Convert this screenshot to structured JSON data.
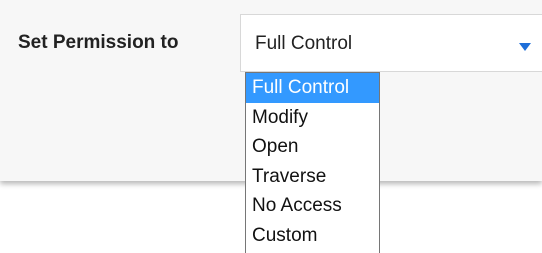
{
  "form": {
    "label": "Set Permission to",
    "selected_value": "Full Control",
    "options": [
      {
        "label": "Full Control",
        "selected": true
      },
      {
        "label": "Modify",
        "selected": false
      },
      {
        "label": "Open",
        "selected": false
      },
      {
        "label": "Traverse",
        "selected": false
      },
      {
        "label": "No Access",
        "selected": false
      },
      {
        "label": "Custom",
        "selected": false
      }
    ]
  },
  "colors": {
    "accent": "#1e6fd9",
    "highlight": "#3399ff",
    "panel_bg": "#f7f7f7"
  },
  "icons": {
    "dropdown": "triangle-down-icon"
  }
}
